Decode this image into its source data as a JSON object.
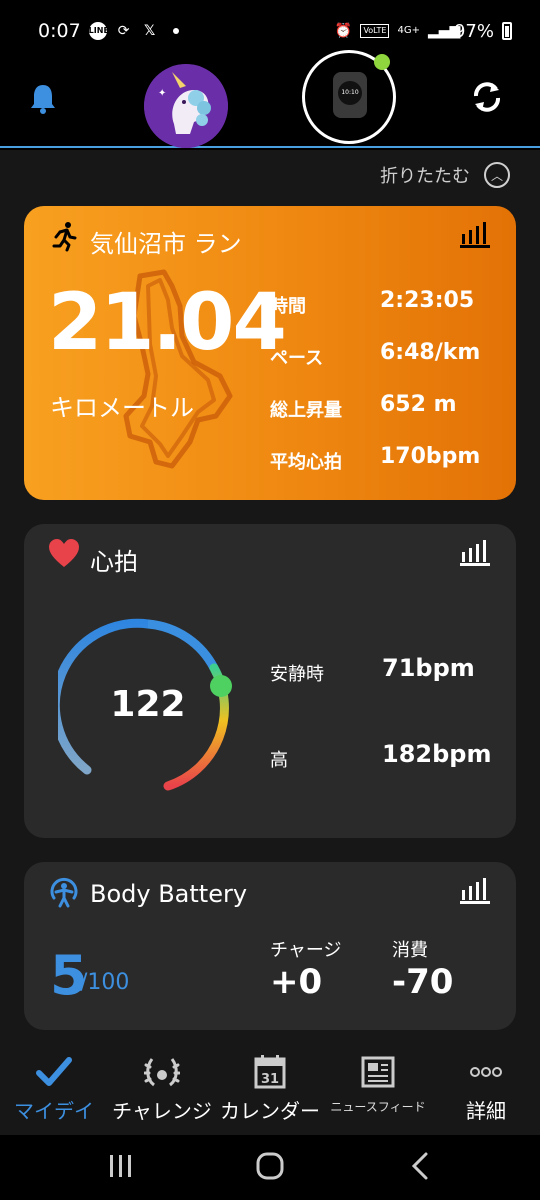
{
  "status_bar": {
    "time": "0:07",
    "battery": "97%",
    "network": "4G+",
    "volte": "VoLTE"
  },
  "header": {
    "collapse_label": "折りたたむ",
    "watch_time": "10:10"
  },
  "activity": {
    "title": "気仙沼市 ラン",
    "distance": "21.04",
    "unit": "キロメートル",
    "stats": [
      {
        "label": "時間",
        "value": "2:23:05"
      },
      {
        "label": "ペース",
        "value": "6:48/km"
      },
      {
        "label": "総上昇量",
        "value": "652 m"
      },
      {
        "label": "平均心拍",
        "value": "170bpm"
      }
    ]
  },
  "heart_rate": {
    "title": "心拍",
    "current": "122",
    "resting_label": "安静時",
    "resting_value": "71bpm",
    "high_label": "高",
    "high_value": "182bpm"
  },
  "body_battery": {
    "title": "Body Battery",
    "value": "5",
    "max": "/100",
    "charge_label": "チャージ",
    "charge_value": "+0",
    "drain_label": "消費",
    "drain_value": "-70"
  },
  "bottom_nav": [
    {
      "label": "マイデイ",
      "active": true
    },
    {
      "label": "チャレンジ"
    },
    {
      "label": "カレンダー",
      "calendar_day": "31"
    },
    {
      "label": "ニュースフィード"
    },
    {
      "label": "詳細"
    }
  ],
  "colors": {
    "accent": "#3d8fe0",
    "run_card": "#f08a12",
    "card_bg": "#2a2a2a",
    "heart": "#e8424a"
  }
}
